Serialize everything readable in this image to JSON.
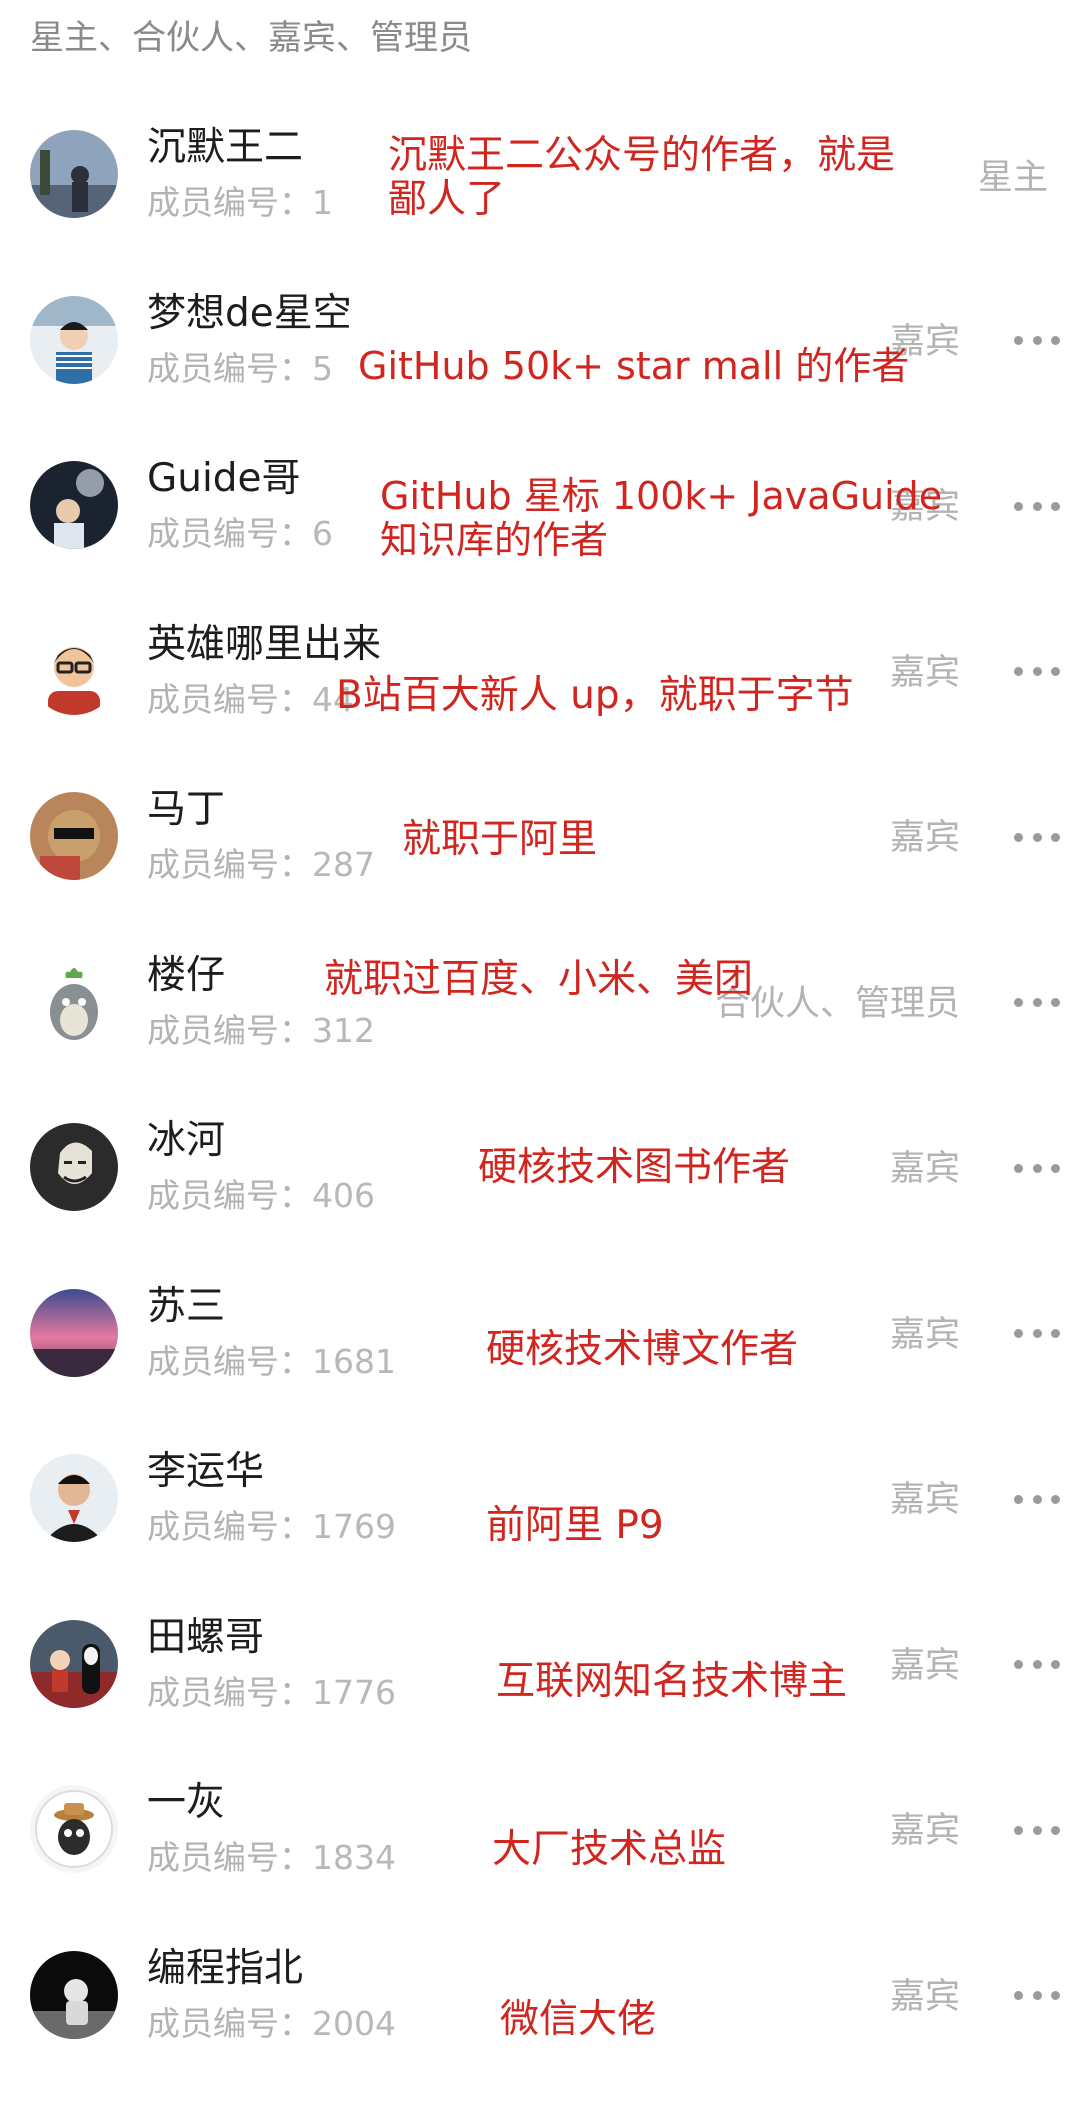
{
  "header": {
    "title": "星主、合伙人、嘉宾、管理员"
  },
  "id_prefix": "成员编号：",
  "members": [
    {
      "name": "沉默王二",
      "id": "1",
      "role": "星主",
      "more": false,
      "annotation": [
        "沉默王二公众号的作者，就是",
        "鄙人了"
      ]
    },
    {
      "name": "梦想de星空",
      "id": "5",
      "role": "嘉宾",
      "more": true,
      "annotation": [
        "GitHub 50k+ star mall 的作者"
      ]
    },
    {
      "name": "Guide哥",
      "id": "6",
      "role": "嘉宾",
      "more": true,
      "annotation": [
        "GitHub  星标  100k+  JavaGuide",
        "知识库的作者"
      ]
    },
    {
      "name": "英雄哪里出来",
      "id": "44",
      "role": "嘉宾",
      "more": true,
      "annotation": [
        "B站百大新人 up，就职于字节"
      ]
    },
    {
      "name": "马丁",
      "id": "287",
      "role": "嘉宾",
      "more": true,
      "annotation": [
        "就职于阿里"
      ]
    },
    {
      "name": "楼仔",
      "id": "312",
      "role": "合伙人、管理员",
      "more": true,
      "annotation": [
        "就职过百度、小米、美团"
      ]
    },
    {
      "name": "冰河",
      "id": "406",
      "role": "嘉宾",
      "more": true,
      "annotation": [
        "硬核技术图书作者"
      ]
    },
    {
      "name": "苏三",
      "id": "1681",
      "role": "嘉宾",
      "more": true,
      "annotation": [
        "硬核技术博文作者"
      ]
    },
    {
      "name": "李运华",
      "id": "1769",
      "role": "嘉宾",
      "more": true,
      "annotation": [
        "前阿里 P9"
      ]
    },
    {
      "name": "田螺哥",
      "id": "1776",
      "role": "嘉宾",
      "more": true,
      "annotation": [
        "互联网知名技术博主"
      ]
    },
    {
      "name": "一灰",
      "id": "1834",
      "role": "嘉宾",
      "more": true,
      "annotation": [
        "大厂技术总监"
      ]
    },
    {
      "name": "编程指北",
      "id": "2004",
      "role": "嘉宾",
      "more": true,
      "annotation": [
        "微信大佬"
      ]
    }
  ],
  "colors": {
    "annotation": "#d0261f",
    "muted": "#b3b3b3",
    "name": "#1d1d1d"
  },
  "icons": {
    "more": "more-dots-icon"
  }
}
